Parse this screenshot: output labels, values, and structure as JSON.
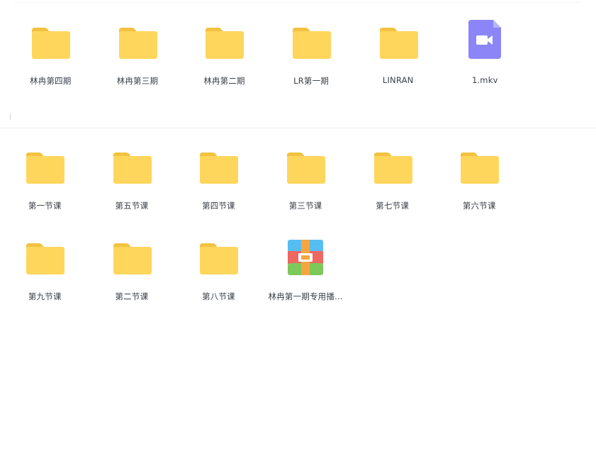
{
  "top_section": {
    "items": [
      {
        "name": "林冉第四期",
        "type": "folder"
      },
      {
        "name": "林冉第三期",
        "type": "folder"
      },
      {
        "name": "林冉第二期",
        "type": "folder"
      },
      {
        "name": "LR第一期",
        "type": "folder"
      },
      {
        "name": "LINRAN",
        "type": "folder"
      },
      {
        "name": "1.mkv",
        "type": "video"
      }
    ]
  },
  "bottom_section": {
    "items": [
      {
        "name": "第一节课",
        "type": "folder"
      },
      {
        "name": "第五节课",
        "type": "folder"
      },
      {
        "name": "第四节课",
        "type": "folder"
      },
      {
        "name": "第三节课",
        "type": "folder"
      },
      {
        "name": "第七节课",
        "type": "folder"
      },
      {
        "name": "第六节课",
        "type": "folder"
      },
      {
        "name": "第九节课",
        "type": "folder"
      },
      {
        "name": "第二节课",
        "type": "folder"
      },
      {
        "name": "第八节课",
        "type": "folder"
      },
      {
        "name": "林冉第一期专用播...",
        "type": "archive"
      }
    ]
  },
  "icons": {
    "folder": "folder-icon",
    "video": "video-file-icon",
    "archive": "archive-file-icon"
  },
  "colors": {
    "folder_body": "#ffd65c",
    "folder_tab": "#f2c240",
    "video_bg": "#8b85f8",
    "archive_blue": "#56bdf0",
    "archive_red": "#ee6761",
    "archive_green": "#7dc85a",
    "archive_strap": "#f6a640"
  }
}
